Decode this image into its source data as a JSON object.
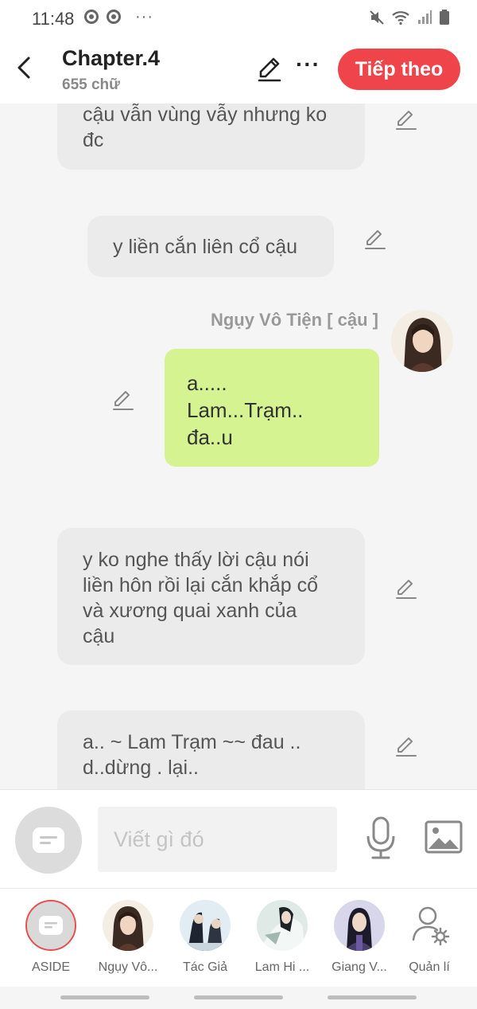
{
  "status_bar": {
    "time": "11:48",
    "more": "···"
  },
  "header": {
    "title": "Chapter.4",
    "word_count": "655 chữ",
    "next_label": "Tiếp theo",
    "more_label": "···"
  },
  "messages": [
    {
      "type": "narration",
      "text": "cậu vẫn vùng vẫy nhưng ko\nđc"
    },
    {
      "type": "narration",
      "text": "y liền cắn liên cổ cậu"
    },
    {
      "type": "character",
      "speaker": "Ngụy Vô Tiện [ cậu ]",
      "text": "a.....\nLam...Trạm..\nđa..u"
    },
    {
      "type": "narration",
      "text": "y ko nghe thấy lời cậu nói\nliền hôn rồi lại cắn khắp cổ\nvà xương quai xanh của\ncậu"
    },
    {
      "type": "narration",
      "text": "a.. ~ Lam Trạm ~~ đau ..\nd..dừng .  lại.."
    }
  ],
  "composer": {
    "placeholder": "Viết gì đó"
  },
  "characters": [
    {
      "label": "ASIDE",
      "icon": "aside-icon"
    },
    {
      "label": "Ngụy Vô...",
      "icon": "avatar"
    },
    {
      "label": "Tác Giả",
      "icon": "avatar"
    },
    {
      "label": "Lam Hi ...",
      "icon": "avatar"
    },
    {
      "label": "Giang V...",
      "icon": "avatar"
    },
    {
      "label": "Quản lí",
      "icon": "manage-user-icon"
    }
  ],
  "colors": {
    "accent": "#f0444b",
    "character_bubble": "#d5f391",
    "narration_bubble": "#ebebeb"
  }
}
